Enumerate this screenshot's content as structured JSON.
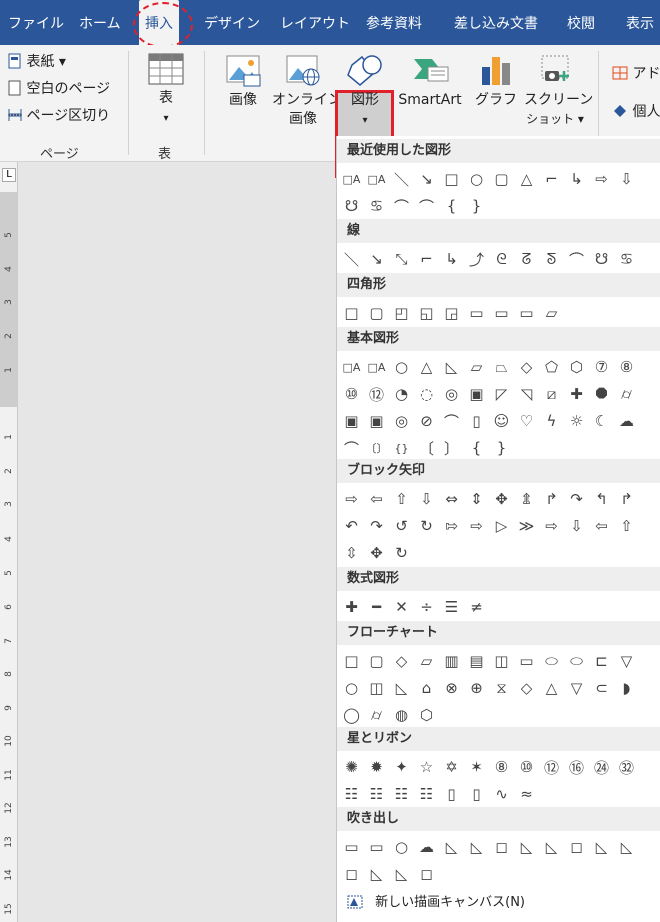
{
  "tabs": [
    "ファイル",
    "ホーム",
    "挿入",
    "デザイン",
    "レイアウト",
    "参考資料",
    "差し込み文書",
    "校閲",
    "表示"
  ],
  "ribbon": {
    "page_group": {
      "items": [
        "表紙 ▾",
        "空白のページ",
        "ページ区切り"
      ],
      "label": "ページ"
    },
    "table_group": {
      "button": "表",
      "caret": "▾",
      "label": "表"
    },
    "illustrations": {
      "image": "画像",
      "online_image_1": "オンライン",
      "online_image_2": "画像",
      "shapes": "図形",
      "shapes_caret": "▾",
      "smartart": "SmartArt",
      "graph": "グラフ",
      "screenshot_1": "スクリーン",
      "screenshot_2": "ショット ▾"
    },
    "addins": {
      "addin": "アド",
      "personal": "個人"
    }
  },
  "ruler_numbers": [
    "5",
    "4",
    "3",
    "2",
    "1",
    "1",
    "2",
    "3",
    "4",
    "5",
    "6",
    "7",
    "8",
    "9",
    "10",
    "11",
    "12",
    "13",
    "14",
    "15"
  ],
  "corner_mark": "L",
  "shapes_menu": {
    "sections": [
      {
        "title": "最近使用した図形",
        "rows": [
          [
            "□A",
            "□A",
            "＼",
            "↘",
            "□",
            "○",
            "▢",
            "△",
            "⌐",
            "↳",
            "⇨",
            "⇩"
          ],
          [
            "☋",
            "♋",
            "⌒",
            "⌒",
            "{",
            "}"
          ]
        ]
      },
      {
        "title": "線",
        "rows": [
          [
            "＼",
            "↘",
            "⤡",
            "⌐",
            "↳",
            "⤴",
            "ᘓ",
            "ᘔ",
            "ᘕ",
            "⌒",
            "☋",
            "♋"
          ]
        ]
      },
      {
        "title": "四角形",
        "rows": [
          [
            "□",
            "▢",
            "◰",
            "◱",
            "◲",
            "▭",
            "▭",
            "▭",
            "▱"
          ]
        ]
      },
      {
        "title": "基本図形",
        "rows": [
          [
            "□A",
            "□A",
            "○",
            "△",
            "◺",
            "▱",
            "⏢",
            "◇",
            "⬠",
            "⬡",
            "⑦",
            "⑧"
          ],
          [
            "⑩",
            "⑫",
            "◔",
            "◌",
            "◎",
            "▣",
            "◸",
            "◹",
            "⧄",
            "✚",
            "⯃",
            "⌭"
          ],
          [
            "▣",
            "▣",
            "◎",
            "⊘",
            "⌒",
            "▯",
            "☺",
            "♡",
            "ϟ",
            "☼",
            "☾",
            "☁"
          ],
          [
            "⌒",
            "〔〕",
            "{}",
            "〔",
            "〕",
            "{",
            "}"
          ]
        ]
      },
      {
        "title": "ブロック矢印",
        "rows": [
          [
            "⇨",
            "⇦",
            "⇧",
            "⇩",
            "⇔",
            "⇕",
            "✥",
            "⇭",
            "↱",
            "↷",
            "↰",
            "↱"
          ],
          [
            "↶",
            "↷",
            "↺",
            "↻",
            "⇰",
            "⇨",
            "▷",
            "≫",
            "⇨",
            "⇩",
            "⇦",
            "⇧"
          ],
          [
            "⇳",
            "✥",
            "↻"
          ]
        ]
      },
      {
        "title": "数式図形",
        "rows": [
          [
            "✚",
            "━",
            "✕",
            "÷",
            "☰",
            "≠"
          ]
        ]
      },
      {
        "title": "フローチャート",
        "rows": [
          [
            "□",
            "▢",
            "◇",
            "▱",
            "▥",
            "▤",
            "◫",
            "▭",
            "⬭",
            "⬭",
            "⊏",
            "▽"
          ],
          [
            "○",
            "◫",
            "◺",
            "⌂",
            "⊗",
            "⊕",
            "⧖",
            "◇",
            "△",
            "▽",
            "⊂",
            "◗"
          ],
          [
            "◯",
            "⌭",
            "◍",
            "⬡"
          ]
        ]
      },
      {
        "title": "星とリボン",
        "rows": [
          [
            "✺",
            "✹",
            "✦",
            "☆",
            "✡",
            "✶",
            "⑧",
            "⑩",
            "⑫",
            "⑯",
            "㉔",
            "㉜"
          ],
          [
            "☷",
            "☷",
            "☷",
            "☷",
            "▯",
            "▯",
            "∿",
            "≈"
          ]
        ]
      },
      {
        "title": "吹き出し",
        "rows": [
          [
            "▭",
            "▭",
            "○",
            "☁",
            "◺",
            "◺",
            "◻",
            "◺",
            "◺",
            "◻",
            "◺",
            "◺"
          ],
          [
            "◻",
            "◺",
            "◺",
            "◻"
          ]
        ]
      }
    ],
    "new_canvas": "新しい描画キャンバス(N)"
  }
}
